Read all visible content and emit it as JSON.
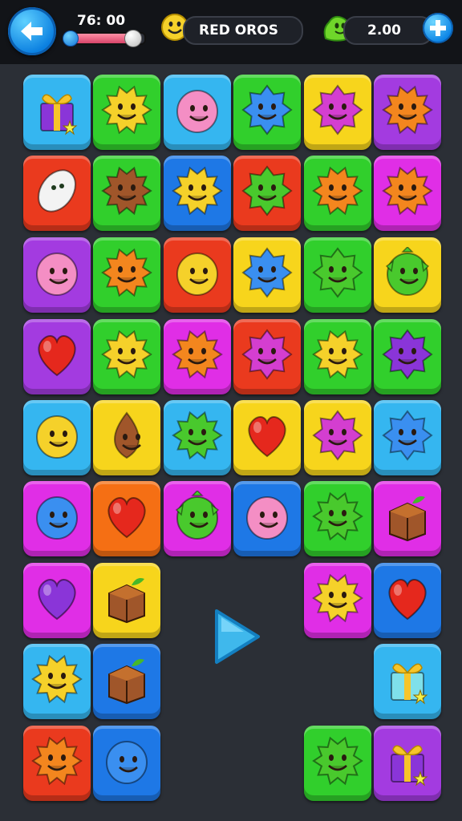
{
  "header": {
    "timer": "76: 00",
    "timer_progress": 0.85,
    "player_name": "RED OROS",
    "coins": "2.00",
    "icons": {
      "back": "back-arrow-icon",
      "player": "smiley-face-icon",
      "coins": "green-blob-icon",
      "add": "plus-icon"
    }
  },
  "board": {
    "columns": 6,
    "rows": 9,
    "tiles": [
      [
        "sky:gift-purple",
        "green:sun-yellow",
        "sky:blob-pink",
        "green:spiky-blue",
        "yellow:spiky-magenta",
        "purple:sun-orange"
      ],
      [
        "red:egg-white",
        "green:sun-brown",
        "blue:sun-yellow",
        "red:spiky-green",
        "green:sun-orange",
        "magenta:sun-orange"
      ],
      [
        "purple:blob-pink",
        "green:sun-orange",
        "red:blob-yellow",
        "yellow:spiky-blue",
        "green:spiky-green",
        "yellow:dragon-green"
      ],
      [
        "purple:heart-red",
        "green:sun-yellow",
        "magenta:sun-orange",
        "red:spiky-magenta",
        "green:sun-yellow",
        "green:spiky-purple"
      ],
      [
        "sky:blob-yellow",
        "yellow:drop-brown",
        "sky:sun-green",
        "yellow:heart-red",
        "yellow:spiky-magenta",
        "sky:spiky-blue"
      ],
      [
        "magenta:blob-blue",
        "orange:heart-red",
        "magenta:dragon-green",
        "blue:blob-pink",
        "green:sun-green",
        "magenta:cake-brown"
      ],
      [
        "magenta:heart-purple",
        "yellow:cake-brown",
        null,
        null,
        "magenta:sun-yellow",
        "blue:heart-red"
      ],
      [
        "sky:sun-yellow",
        "blue:cake-brown",
        null,
        null,
        null,
        "sky:gift-teal"
      ],
      [
        "red:sun-orange",
        "blue:blob-blue",
        null,
        null,
        "green:sun-green",
        "purple:gift-purple"
      ]
    ]
  },
  "play_icon": "play-icon",
  "colors": {
    "sky": "#35b6f0",
    "green": "#31cf2c",
    "yellow": "#f7d51c",
    "red": "#ea3a1e",
    "purple": "#a33be0",
    "magenta": "#e02ee6",
    "blue": "#1e78e6",
    "orange": "#f56f14"
  }
}
